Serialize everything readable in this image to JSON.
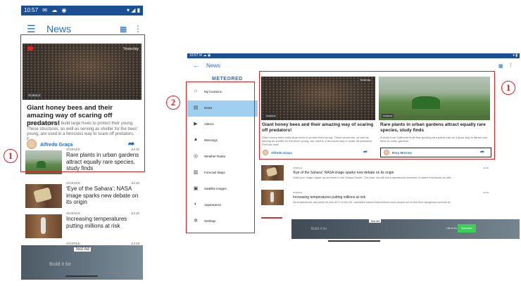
{
  "phone": {
    "status": {
      "time": "10:57",
      "icons": [
        "gmail-icon",
        "cloud-icon",
        "circle-app-icon",
        "wifi-icon",
        "signal-icon",
        "battery-icon"
      ]
    },
    "appbar": {
      "title": "News",
      "menu_icon": "hamburger-icon",
      "view_icon": "grid-icon",
      "more_icon": "more-vertical-icon"
    },
    "featured": {
      "tag": "SCIENCE",
      "time": "Yesterday",
      "headline": "Giant honey bees and their amazing way of scaring off predators!",
      "summary": "Giant honey bees build large hives to protect their young. These structures, as well as serving as shelter for the bees' young, are used in a ferocious way to scare off predators. F...",
      "author": "Alfredo Graça"
    },
    "list": [
      {
        "category": "SCIENCE",
        "date": "Jul 31",
        "headline": "Rare plants in urban gardens attract equally rare species, study finds"
      },
      {
        "category": "SCIENCE",
        "date": "Jul 30",
        "headline": "'Eye of the Sahara': NASA image sparks new debate on its origin"
      },
      {
        "category": "SCIENCE",
        "date": "Jul 30",
        "headline": "Increasing temperatures putting millions at risk"
      },
      {
        "category": "SCIENCE",
        "date": "Jul 29",
        "headline": ""
      }
    ],
    "ad": {
      "label": "Test Ad",
      "text": "Build it for"
    }
  },
  "tablet": {
    "status": {
      "time": "10:57"
    },
    "appbar": {
      "title": "News"
    },
    "drawer": {
      "brand": "METEORED",
      "items": [
        {
          "label": "My locations",
          "icon": "home-icon"
        },
        {
          "label": "News",
          "icon": "news-icon",
          "active": true
        },
        {
          "label": "Videos",
          "icon": "play-icon"
        },
        {
          "label": "Warnings",
          "icon": "warning-icon"
        },
        {
          "label": "Weather Radar",
          "icon": "radar-icon"
        },
        {
          "label": "Forecast Maps",
          "icon": "map-icon"
        },
        {
          "label": "Satellite images",
          "icon": "satellite-icon"
        },
        {
          "label": "Appearance",
          "icon": "palette-icon"
        },
        {
          "label": "Settings",
          "icon": "settings-icon"
        }
      ]
    },
    "cards": [
      {
        "tag": "SCIENCE",
        "time": "Yesterday",
        "headline": "Giant honey bees and their amazing way of scaring off predators!",
        "summary": "Giant honey bees build large hives to protect their young. These structures, as well as serving as shelter for the bees' young, are used in a ferocious way to scare off predators. Find out how!",
        "author": "Alfredo Graça"
      },
      {
        "tag": "SCIENCE",
        "headline": "Rare plants in urban gardens attract equally rare species, study finds",
        "summary": "A study from California finds that growing rare plants can be a good way to attract rare bees to urban gardens.",
        "author": "Rory Morrow"
      }
    ],
    "rows": [
      {
        "category": "SCIENCE",
        "date": "Jul 30",
        "headline": "'Eye of the Sahara': NASA image sparks new debate on its origin",
        "summary": "Grab your 'magic carpet' as we travel to the Sahara Desert. This time, we will visit a spectacular structure of nature that leaves us with ..."
      },
      {
        "category": "SCIENCE",
        "date": "Jul 30",
        "headline": "Increasing temperatures putting millions at risk",
        "summary": "As temperatures last week hit over 40°C in the UK, scientists warned that millions more people are at risk from dangerous summer te..."
      }
    ],
    "ad": {
      "label": "Test Ad",
      "text": "Build it for",
      "tagline": "Life Is On",
      "brand": "Schneider"
    }
  },
  "annotations": {
    "callout_1": "1",
    "callout_2": "2",
    "callout_3": "1"
  },
  "colors": {
    "accent": "#1e6fc4",
    "status_bar": "#1b4f93",
    "drawer_active": "#9fd0f2",
    "annotation": "#e02020"
  }
}
